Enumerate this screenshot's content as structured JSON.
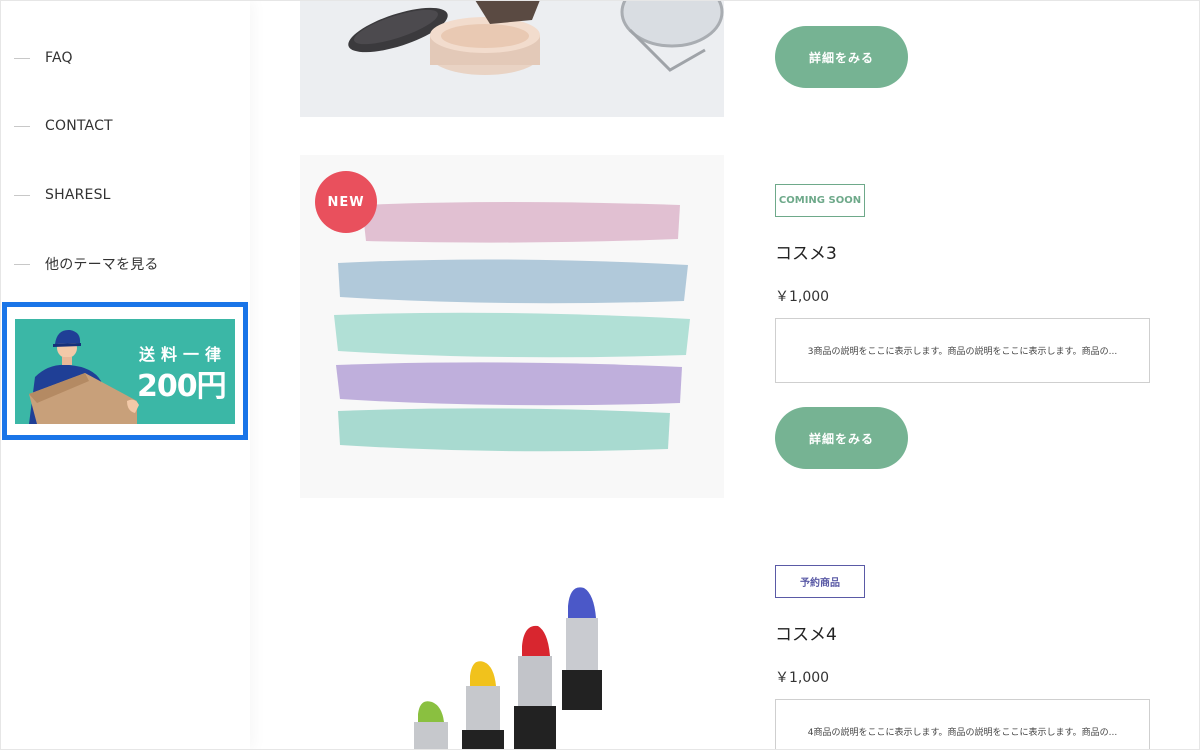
{
  "sidebar": {
    "items": [
      {
        "label": "FAQ"
      },
      {
        "label": "CONTACT"
      },
      {
        "label": "SHARESL"
      },
      {
        "label": "他のテーマを見る"
      }
    ],
    "banner": {
      "top_text": "送料一律",
      "big_text": "200円"
    }
  },
  "products": [
    {
      "button_label": "詳細をみる"
    },
    {
      "badge": "NEW",
      "tag": "COMING SOON",
      "name": "コスメ3",
      "price": "￥1,000",
      "description": "3商品の説明をここに表示します。商品の説明をここに表示します。商品の...",
      "button_label": "詳細をみる"
    },
    {
      "tag": "予約商品",
      "name": "コスメ4",
      "price": "￥1,000",
      "description": "4商品の説明をここに表示します。商品の説明をここに表示します。商品の..."
    }
  ],
  "colors": {
    "accent_green": "#76b393",
    "new_badge": "#e9505d",
    "banner_bg": "#3bb7a6",
    "highlight_border": "#1a75e8",
    "preorder_tag": "#5a5aa6"
  }
}
